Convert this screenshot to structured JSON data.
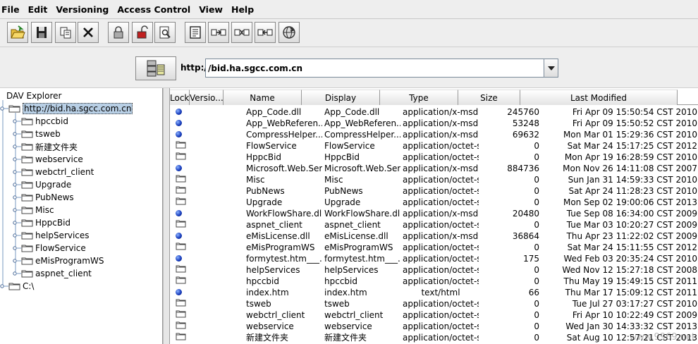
{
  "menu": [
    "File",
    "Edit",
    "Versioning",
    "Access Control",
    "View",
    "Help"
  ],
  "toolbar": [
    {
      "name": "open-folder-icon"
    },
    {
      "name": "save-icon"
    },
    {
      "name": "copy-icon"
    },
    {
      "name": "delete-icon"
    },
    {
      "name": "lock-icon"
    },
    {
      "name": "unlock-icon"
    },
    {
      "name": "view-properties-icon"
    },
    {
      "name": "document-icon"
    },
    {
      "name": "version-control-icon"
    },
    {
      "name": "checkout-icon"
    },
    {
      "name": "checkin-icon"
    },
    {
      "name": "refresh-globe-icon"
    }
  ],
  "address": {
    "protocol": "http://",
    "url": "/bid.ha.sgcc.com.cn"
  },
  "tree": {
    "root": "DAV Explorer",
    "host": "http://bid.ha.sgcc.com.cn",
    "children": [
      "hpccbid",
      "tsweb",
      "新建文件夹",
      "webservice",
      "webctrl_client",
      "Upgrade",
      "PubNews",
      "Misc",
      "HppcBid",
      "helpServices",
      "FlowService",
      "eMisProgramWS",
      "aspnet_client"
    ],
    "drive": "C:\\"
  },
  "table": {
    "columns": [
      "Lock",
      "Versio...",
      "Name",
      "Display",
      "Type",
      "Size",
      "Last Modified"
    ],
    "rows": [
      {
        "kind": "file",
        "name": "App_Code.dll",
        "display": "App_Code.dll",
        "type": "application/x-msd...",
        "size": "245760",
        "modified": "Fri Apr 09 15:50:54 CST 2010"
      },
      {
        "kind": "file",
        "name": "App_WebReferen...",
        "display": "App_WebReferen...",
        "type": "application/x-msd...",
        "size": "53248",
        "modified": "Fri Apr 09 15:50:52 CST 2010"
      },
      {
        "kind": "file",
        "name": "CompressHelper....",
        "display": "CompressHelper....",
        "type": "application/x-msd...",
        "size": "69632",
        "modified": "Mon Mar 01 15:29:36 CST 2010"
      },
      {
        "kind": "folder",
        "name": "FlowService",
        "display": "FlowService",
        "type": "application/octet-s...",
        "size": "0",
        "modified": "Sat Mar 24 15:17:25 CST 2012"
      },
      {
        "kind": "folder",
        "name": "HppcBid",
        "display": "HppcBid",
        "type": "application/octet-s...",
        "size": "0",
        "modified": "Mon Apr 19 16:28:59 CST 2010"
      },
      {
        "kind": "file",
        "name": "Microsoft.Web.Ser...",
        "display": "Microsoft.Web.Ser...",
        "type": "application/x-msd...",
        "size": "884736",
        "modified": "Mon Nov 26 14:11:08 CST 2007"
      },
      {
        "kind": "folder",
        "name": "Misc",
        "display": "Misc",
        "type": "application/octet-s...",
        "size": "0",
        "modified": "Sun Jan 31 14:59:33 CST 2010"
      },
      {
        "kind": "folder",
        "name": "PubNews",
        "display": "PubNews",
        "type": "application/octet-s...",
        "size": "0",
        "modified": "Sat Apr 24 11:28:23 CST 2010"
      },
      {
        "kind": "folder",
        "name": "Upgrade",
        "display": "Upgrade",
        "type": "application/octet-s...",
        "size": "0",
        "modified": "Mon Sep 02 19:00:06 CST 2013"
      },
      {
        "kind": "file",
        "name": "WorkFlowShare.dll",
        "display": "WorkFlowShare.dll",
        "type": "application/x-msd...",
        "size": "20480",
        "modified": "Tue Sep 08 16:34:00 CST 2009"
      },
      {
        "kind": "folder",
        "name": "aspnet_client",
        "display": "aspnet_client",
        "type": "application/octet-s...",
        "size": "0",
        "modified": "Tue Mar 03 10:20:27 CST 2009"
      },
      {
        "kind": "file",
        "name": "eMisLicense.dll",
        "display": "eMisLicense.dll",
        "type": "application/x-msd...",
        "size": "36864",
        "modified": "Thu Apr 23 11:22:02 CST 2009"
      },
      {
        "kind": "folder",
        "name": "eMisProgramWS",
        "display": "eMisProgramWS",
        "type": "application/octet-s...",
        "size": "0",
        "modified": "Sat Mar 24 15:11:55 CST 2012"
      },
      {
        "kind": "file",
        "name": "formytest.htm___...",
        "display": "formytest.htm___...",
        "type": "application/octet-s...",
        "size": "175",
        "modified": "Wed Feb 03 20:35:24 CST 2010"
      },
      {
        "kind": "folder",
        "name": "helpServices",
        "display": "helpServices",
        "type": "application/octet-s...",
        "size": "0",
        "modified": "Wed Nov 12 15:27:18 CST 2008"
      },
      {
        "kind": "folder",
        "name": "hpccbid",
        "display": "hpccbid",
        "type": "application/octet-s...",
        "size": "0",
        "modified": "Thu May 19 15:49:15 CST 2011"
      },
      {
        "kind": "file",
        "name": "index.htm",
        "display": "index.htm",
        "type": "text/html",
        "size": "66",
        "modified": "Thu Mar 17 15:09:12 CST 2011"
      },
      {
        "kind": "folder",
        "name": "tsweb",
        "display": "tsweb",
        "type": "application/octet-s...",
        "size": "0",
        "modified": "Tue Jul 27 03:17:27 CST 2010"
      },
      {
        "kind": "folder",
        "name": "webctrl_client",
        "display": "webctrl_client",
        "type": "application/octet-s...",
        "size": "0",
        "modified": "Fri Apr 10 10:22:49 CST 2009"
      },
      {
        "kind": "folder",
        "name": "webservice",
        "display": "webservice",
        "type": "application/octet-s...",
        "size": "0",
        "modified": "Wed Jan 30 14:33:32 CST 2013"
      },
      {
        "kind": "folder",
        "name": "新建文件夹",
        "display": "新建文件夹",
        "type": "application/octet-s...",
        "size": "0",
        "modified": "Sat Aug 10 12:57:21 CST 2013"
      }
    ]
  },
  "watermark": "www.9969.net"
}
